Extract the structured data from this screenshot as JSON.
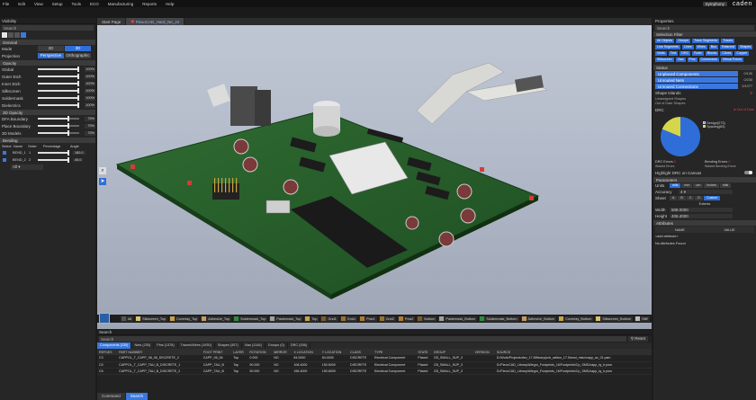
{
  "menu": {
    "items": [
      "File",
      "Edit",
      "View",
      "Setup",
      "Tools",
      "ECO",
      "Manufacturing",
      "Reports",
      "Help"
    ],
    "user_pill": "Symphony",
    "brand": "caden"
  },
  "tabs": [
    {
      "label": "Start Page"
    },
    {
      "label": "FlexoCAD_Hard_Ne_J4"
    }
  ],
  "visibility": {
    "title": "Visibility",
    "search_placeholder": "Search",
    "general_label": "General",
    "mode_label": "Mode",
    "mode_options": [
      "2D",
      "3D"
    ],
    "projection_label": "Projection",
    "projection_options": [
      "Perspective",
      "Orthographic"
    ],
    "opacity_label": "Opacity",
    "opacity": [
      {
        "label": "Global",
        "pct": "100%",
        "frac": 1.0
      },
      {
        "label": "Outer Etch",
        "pct": "100%",
        "frac": 1.0
      },
      {
        "label": "Inner Etch",
        "pct": "100%",
        "frac": 1.0
      },
      {
        "label": "Silkscreen",
        "pct": "100%",
        "frac": 1.0
      },
      {
        "label": "Soldermask",
        "pct": "100%",
        "frac": 1.0
      },
      {
        "label": "Dielectrics",
        "pct": "100%",
        "frac": 1.0
      }
    ],
    "opacity3d_label": "3D Opacity",
    "opacity3d": [
      {
        "label": "DFA Boundary",
        "pct": "75%",
        "frac": 0.75
      },
      {
        "label": "Place Boundary",
        "pct": "75%",
        "frac": 0.75
      },
      {
        "label": "3D Models",
        "pct": "75%",
        "frac": 0.75
      }
    ],
    "bending_label": "Bending",
    "bending_headers": [
      "Select",
      "Name",
      "Order",
      "Percentage",
      "Angle"
    ],
    "bending_rows": [
      {
        "name": "BEND_1",
        "order": "1",
        "angle": "180.0"
      },
      {
        "name": "BEND_2",
        "order": "2",
        "angle": "45.0"
      }
    ],
    "bending_all": "All"
  },
  "viewport_icons": [
    "zoom-icon",
    "select-arrow-icon"
  ],
  "layers": [
    {
      "label": "All",
      "color": "#555555"
    },
    {
      "label": "Silkscreen_Top",
      "color": "#d8c36a"
    },
    {
      "label": "Coverlay_Top",
      "color": "#c9a24a"
    },
    {
      "label": "Adhesive_Top",
      "color": "#c89a62"
    },
    {
      "label": "Soldermask_Top",
      "color": "#2f8a3a"
    },
    {
      "label": "Pastemask_Top",
      "color": "#a0a0a0"
    },
    {
      "label": "Top",
      "color": "#c8a24a"
    },
    {
      "label": "Gnd1",
      "color": "#7a5a2a"
    },
    {
      "label": "Gnd1",
      "color": "#9a7030"
    },
    {
      "label": "Pow1",
      "color": "#b07a30"
    },
    {
      "label": "Gnd2",
      "color": "#9a7030"
    },
    {
      "label": "Pow2",
      "color": "#b07a30"
    },
    {
      "label": "Bottom",
      "color": "#7a5a2a"
    },
    {
      "label": "Pastemask_Bottom",
      "color": "#a0a0a0"
    },
    {
      "label": "Soldermask_Bottom",
      "color": "#2f8a3a"
    },
    {
      "label": "Adhesive_Bottom",
      "color": "#c89a62"
    },
    {
      "label": "Coverlay_Bottom",
      "color": "#c9a24a"
    },
    {
      "label": "Silkscreen_Bottom",
      "color": "#d8c36a"
    },
    {
      "label": "Stiff",
      "color": "#bbbbbb"
    }
  ],
  "search": {
    "title": "Search",
    "placeholder": "Search",
    "reset": "Reset",
    "tabs": [
      "Components (130)",
      "Nets (230)",
      "Pins (1378)",
      "Traces/Wires (1930)",
      "Shapes (307)",
      "Vias (1146)",
      "Groups (0)",
      "DRC (336)"
    ],
    "headers": [
      "REFDES",
      "PART NUMBER",
      "FOOT PRINT",
      "LAYER",
      "ROTATION",
      "MIRROR",
      "X LOCATION",
      "Y LOCATION",
      "CLASS",
      "TYPE",
      "STATE",
      "GROUP",
      "VERSION",
      "SOURCE"
    ],
    "rows": [
      [
        "C3",
        "CAPPOL_T_CAPP_08_06_DISCRETE_2",
        "CAPP_06_06",
        "Top",
        "0.000",
        "NO",
        "84.0000",
        "84.0000",
        "DISCRETE",
        "Electrical Component",
        "Placed",
        "CB_SMALL_SUP_3",
        "",
        "D:/Work/Projects/dev_17.5/library/pcb_aditon_17.5/smd_misc/capp_ax_01.psm"
      ],
      [
        "C5",
        "CAPPOL_T_CAPP_TAU_B_DISCRETE_1",
        "CAPP_TAU_B",
        "Top",
        "90.000",
        "NO",
        "108.4000",
        "150.6000",
        "DISCRETE",
        "Electrical Component",
        "Placed",
        "CB_SMALL_SUP_3",
        "",
        "D:/FlexoCAD_Library/Allegro_Footprints_16/Footprints/Cp_SMD/capp_tq_b.psm"
      ],
      [
        "C6",
        "CAPPOL_T_CAPP_TAU_B_DISCRETE_2",
        "CAPP_TAU_B",
        "Top",
        "90.000",
        "NO",
        "156.4000",
        "150.6000",
        "DISCRETE",
        "Electrical Component",
        "Placed",
        "CB_SMALL_SUP_3",
        "",
        "D:/FlexoCAD_Library/Allegro_Footprints_16/Footprints/Cp_SMD/capp_tq_b.psm"
      ]
    ]
  },
  "bottom_tabs": [
    "Command",
    "Search"
  ],
  "properties": {
    "title": "Properties",
    "search_placeholder": "Search",
    "selection_filter": "Selection Filter",
    "filter_chips": [
      "All Objects",
      "Groups",
      "Trace Segments",
      "Traces",
      "Line Segments",
      "Lines",
      "Wires",
      "Bus",
      "Ratsnest",
      "Shapes",
      "Voids",
      "Text",
      "DRC",
      "Ruler",
      "Blocks",
      "Clines",
      "Copper",
      "Silkscreen",
      "Vias",
      "Pins",
      "Connectors",
      "Virtual Points"
    ],
    "status_label": "Status",
    "status_bars": [
      {
        "label": "Unplaced Components",
        "value": "0/130"
      },
      {
        "label": "Unrouted Nets",
        "value": "0/230"
      },
      {
        "label": "Unrouted Connections",
        "value": "0/1077"
      }
    ],
    "shape_islands_label": "Shape Islands",
    "shape_islands_value": "0",
    "unassigned_shapes": "Unassigned Shapes",
    "out_of_date_shapes": "Out of Date Shapes",
    "drc_label": "DRC",
    "out_of_date": "Out of Date",
    "drc_legend": [
      {
        "label": "Design(273)",
        "color": "#2f6ed8"
      },
      {
        "label": "Spacing(63)",
        "color": "#d6d64a"
      }
    ],
    "drc_pie": [
      {
        "value": 273,
        "color": "#2f6ed8"
      },
      {
        "value": 63,
        "color": "#d6d64a"
      }
    ],
    "drc_errors_label": "DRC Errors",
    "drc_errors_value": "0",
    "waived_drc_label": "Waived Errors",
    "bending_errors_label": "Bending Errors",
    "bending_errors_value": "0",
    "waived_bending_label": "Waived Bending Errors",
    "highlight_label": "Highlight DRC on Canvas",
    "parameters_label": "Parameters",
    "units_label": "Units",
    "units_options": [
      "mils",
      "mm",
      "um",
      "inches",
      "mils"
    ],
    "accuracy_label": "Accuracy",
    "accuracy_value": "4",
    "sheet_label": "Sheet",
    "sheet_options": [
      "A",
      "B",
      "C",
      "D",
      "Custom"
    ],
    "extents_label": "Extents",
    "width_label": "Width",
    "width_value": "508.0000",
    "height_label": "Height",
    "height_value": "406.4000",
    "attributes_label": "Attributes",
    "attr_headers": [
      "NAME",
      "VALUE"
    ],
    "add_attribute": "<add attribute>",
    "no_attributes": "No Attributes Found"
  }
}
